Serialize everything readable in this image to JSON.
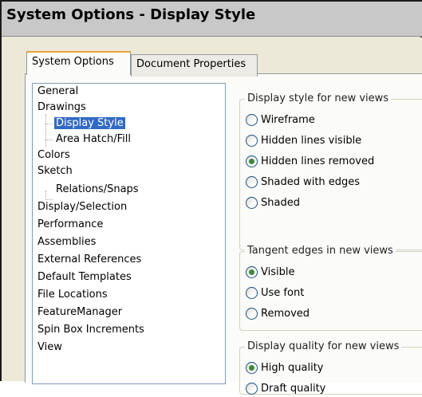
{
  "window": {
    "title": "System Options - Display Style"
  },
  "tabs": [
    {
      "label": "System Options",
      "active": true
    },
    {
      "label": "Document Properties",
      "active": false
    }
  ],
  "tree": {
    "items": [
      {
        "label": "General",
        "level": 0,
        "selected": false
      },
      {
        "label": "Drawings",
        "level": 0,
        "selected": false
      },
      {
        "label": "Display Style",
        "level": 1,
        "selected": true
      },
      {
        "label": "Area Hatch/Fill",
        "level": 1,
        "selected": false
      },
      {
        "label": "Colors",
        "level": 0,
        "selected": false
      },
      {
        "label": "Sketch",
        "level": 0,
        "selected": false
      },
      {
        "label": "Relations/Snaps",
        "level": 1,
        "selected": false
      },
      {
        "label": "Display/Selection",
        "level": 0,
        "selected": false
      },
      {
        "label": "Performance",
        "level": 0,
        "selected": false
      },
      {
        "label": "Assemblies",
        "level": 0,
        "selected": false
      },
      {
        "label": "External References",
        "level": 0,
        "selected": false
      },
      {
        "label": "Default Templates",
        "level": 0,
        "selected": false
      },
      {
        "label": "File Locations",
        "level": 0,
        "selected": false
      },
      {
        "label": "FeatureManager",
        "level": 0,
        "selected": false
      },
      {
        "label": "Spin Box Increments",
        "level": 0,
        "selected": false
      },
      {
        "label": "View",
        "level": 0,
        "selected": false
      }
    ]
  },
  "groups": {
    "display_style": {
      "legend": "Display style for new views",
      "options": [
        {
          "label": "Wireframe",
          "checked": false
        },
        {
          "label": "Hidden lines visible",
          "checked": false
        },
        {
          "label": "Hidden lines removed",
          "checked": true
        },
        {
          "label": "Shaded with edges",
          "checked": false
        },
        {
          "label": "Shaded",
          "checked": false
        }
      ]
    },
    "tangent_edges": {
      "legend": "Tangent edges in new views",
      "options": [
        {
          "label": "Visible",
          "checked": true
        },
        {
          "label": "Use font",
          "checked": false
        },
        {
          "label": "Removed",
          "checked": false
        }
      ]
    },
    "display_quality": {
      "legend": "Display quality for new views",
      "options": [
        {
          "label": "High quality",
          "checked": true
        },
        {
          "label": "Draft quality",
          "checked": false
        }
      ]
    }
  },
  "colors": {
    "selection": "#316ac5",
    "radio_dot": "#3c8a3c",
    "active_tab_accent": "#e8a33d"
  }
}
